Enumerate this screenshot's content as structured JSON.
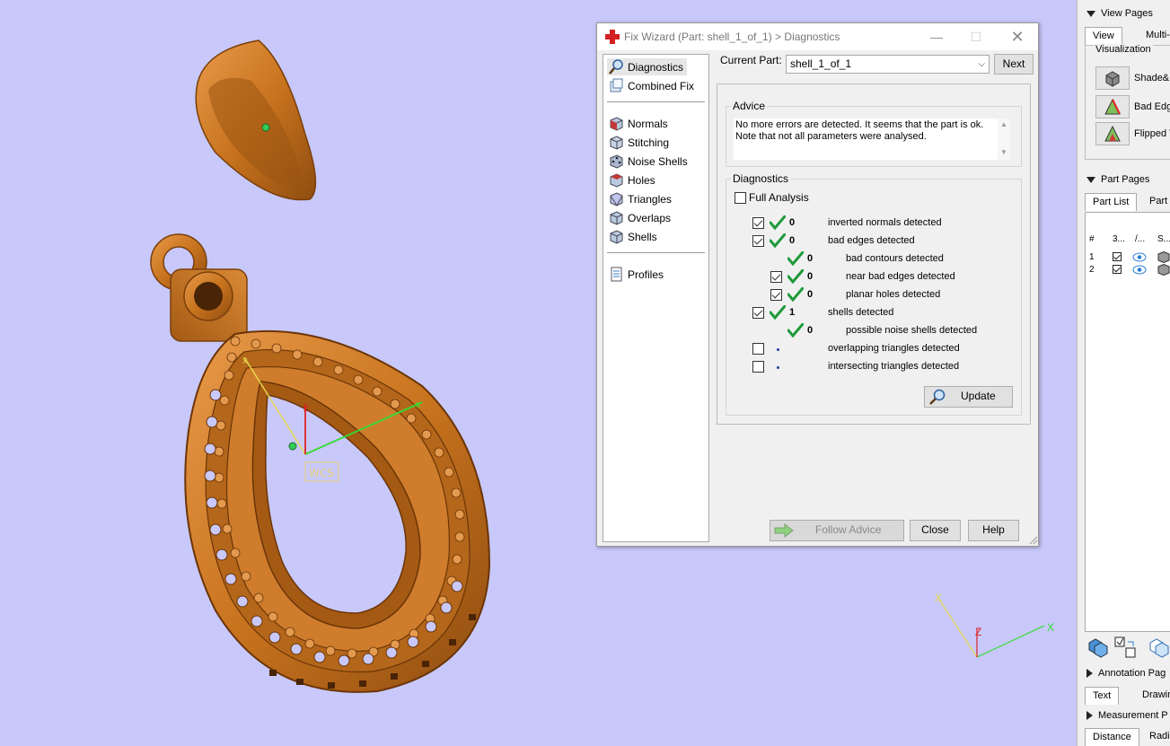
{
  "viewport": {
    "wcs_label": "WCS",
    "model_color": "#c8731e",
    "background": "#c8c8fa"
  },
  "dialog": {
    "title": "Fix Wizard (Part: shell_1_of_1) > Diagnostics",
    "nav": {
      "top": [
        {
          "label": "Diagnostics",
          "icon": "magnifier-icon",
          "selected": true
        },
        {
          "label": "Combined Fix",
          "icon": "combined-fix-icon",
          "selected": false
        }
      ],
      "middle": [
        {
          "label": "Normals",
          "icon": "normals-cube-icon"
        },
        {
          "label": "Stitching",
          "icon": "stitching-cube-icon"
        },
        {
          "label": "Noise Shells",
          "icon": "noise-shells-cube-icon"
        },
        {
          "label": "Holes",
          "icon": "holes-cube-icon"
        },
        {
          "label": "Triangles",
          "icon": "triangles-cube-icon"
        },
        {
          "label": "Overlaps",
          "icon": "overlaps-cube-icon"
        },
        {
          "label": "Shells",
          "icon": "shells-cube-icon"
        }
      ],
      "bottom": [
        {
          "label": "Profiles",
          "icon": "profiles-document-icon"
        }
      ]
    },
    "current_part_label": "Current Part:",
    "current_part_value": "shell_1_of_1",
    "next_label": "Next",
    "advice_title": "Advice",
    "advice_line1": "No more errors are detected. It seems that the part is ok.",
    "advice_line2": "Note that not all parameters were analysed.",
    "diagnostics_title": "Diagnostics",
    "full_analysis_label": "Full Analysis",
    "rows": [
      {
        "checked": true,
        "status": "ok",
        "count": "0",
        "text": "inverted normals detected",
        "indent": 0
      },
      {
        "checked": true,
        "status": "ok",
        "count": "0",
        "text": "bad edges detected",
        "indent": 0
      },
      {
        "checked": null,
        "status": "ok",
        "count": "0",
        "text": "bad contours detected",
        "indent": 1
      },
      {
        "checked": true,
        "status": "ok",
        "count": "0",
        "text": "near bad edges detected",
        "indent": 1
      },
      {
        "checked": true,
        "status": "ok",
        "count": "0",
        "text": "planar holes detected",
        "indent": 1
      },
      {
        "checked": true,
        "status": "ok",
        "count": "1",
        "text": "shells detected",
        "indent": 0
      },
      {
        "checked": null,
        "status": "ok",
        "count": "0",
        "text": "possible noise shells detected",
        "indent": 1
      },
      {
        "checked": false,
        "status": "unknown",
        "count": "",
        "text": "overlapping triangles detected",
        "indent": 0
      },
      {
        "checked": false,
        "status": "unknown",
        "count": "",
        "text": "intersecting triangles detected",
        "indent": 0
      }
    ],
    "update_label": "Update",
    "follow_advice_label": "Follow Advice",
    "close_label": "Close",
    "help_label": "Help"
  },
  "right_panel": {
    "view_pages_title": "View Pages",
    "view_tab": "View",
    "multi_tab": "Multi-",
    "visualization_title": "Visualization",
    "vis_items": [
      "Shade&",
      "Bad Edg",
      "Flipped T"
    ],
    "part_pages_title": "Part Pages",
    "part_list_tab": "Part List",
    "part_tab": "Part",
    "columns": [
      "#",
      "3...",
      "/...",
      "S..."
    ],
    "rows": [
      "1",
      "2"
    ],
    "annotation_title": "Annotation Pag",
    "text_tab": "Text",
    "drawing_tab": "Drawin",
    "measurement_title": "Measurement P",
    "distance_tab": "Distance",
    "radius_tab": "Radi"
  }
}
